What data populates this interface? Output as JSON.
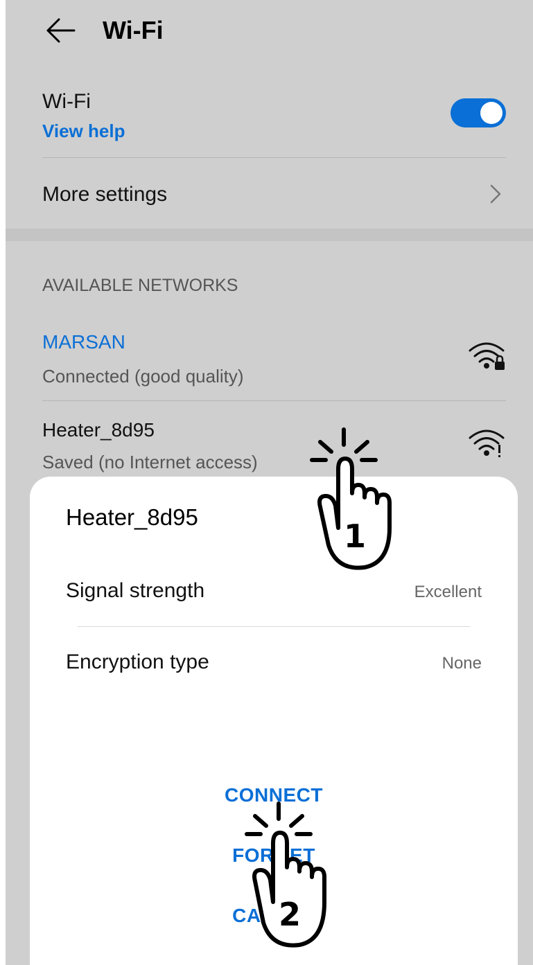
{
  "header": {
    "title": "Wi-Fi",
    "back_icon": "arrow-left-icon"
  },
  "wifi_toggle": {
    "label": "Wi-Fi",
    "help_link": "View help",
    "state": "on",
    "accent": "#0a6fd6"
  },
  "more_settings": {
    "label": "More settings"
  },
  "available_networks": {
    "header": "AVAILABLE NETWORKS",
    "items": [
      {
        "name": "MARSAN",
        "status": "Connected (good quality)",
        "icon": "wifi-lock-icon",
        "name_color": "#0a6fd6"
      },
      {
        "name": "Heater_8d95",
        "status": "Saved (no Internet access)",
        "icon": "wifi-alert-icon",
        "name_color": "#111111"
      }
    ]
  },
  "dialog": {
    "title": "Heater_8d95",
    "rows": [
      {
        "label": "Signal strength",
        "value": "Excellent"
      },
      {
        "label": "Encryption type",
        "value": "None"
      }
    ],
    "actions": {
      "connect": "CONNECT",
      "forget": "FORGET",
      "cancel": "CANCEL"
    }
  },
  "annotations": [
    {
      "step": "1",
      "icon": "tap-hand-icon"
    },
    {
      "step": "2",
      "icon": "tap-hand-icon"
    }
  ]
}
